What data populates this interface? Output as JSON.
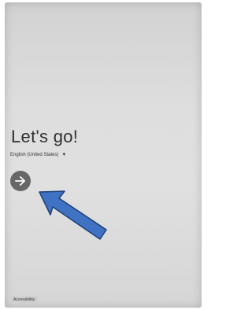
{
  "welcome": {
    "headline": "Let's go!",
    "language": "English (United States)",
    "language_caret_icon": "caret-down-icon",
    "next_icon": "arrow-right-icon"
  },
  "footer": {
    "accessibility_label": "Accessibility"
  },
  "annotation": {
    "arrow_color": "#3f72c2",
    "arrow_outline": "#1f3f77"
  },
  "colors": {
    "background": "#dedede",
    "next_button": "#676767",
    "text": "#2f2f2f"
  }
}
